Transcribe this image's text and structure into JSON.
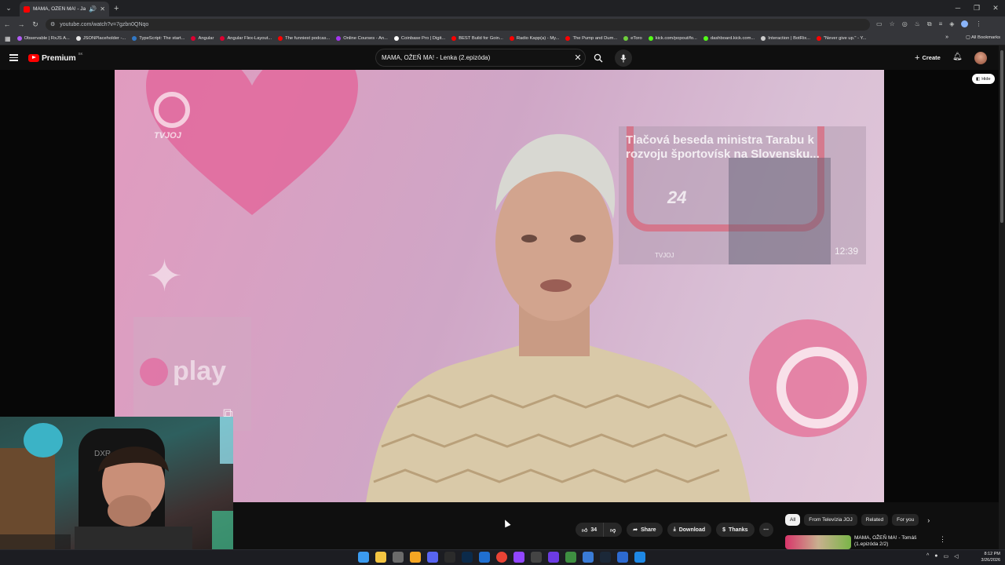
{
  "browser": {
    "tab_title": "MAMA, OŽEŇ MA! - Jarka |",
    "address": "youtube.com/watch?v=7gzbn0QNqo",
    "bookmarks": [
      {
        "label": "Observable | RxJS A...",
        "color": "#b05cf5"
      },
      {
        "label": "JSONPlaceholder -...",
        "color": "#e8e8e8"
      },
      {
        "label": "TypeScript: The start...",
        "color": "#3178c6"
      },
      {
        "label": "Angular",
        "color": "#dd0031"
      },
      {
        "label": "Angular Flex-Layout...",
        "color": "#dd0031"
      },
      {
        "label": "The funniest podcas...",
        "color": "#ff0000"
      },
      {
        "label": "Online Courses - An...",
        "color": "#a435f0"
      },
      {
        "label": "Coinbase Pro | Digit...",
        "color": "#ffffff"
      },
      {
        "label": "BEST Build for Goin...",
        "color": "#ff0000"
      },
      {
        "label": "Radio Kapp(a) - My...",
        "color": "#ff0000"
      },
      {
        "label": "The Pump and Dum...",
        "color": "#ff0000"
      },
      {
        "label": "eToro",
        "color": "#6fcf3c"
      },
      {
        "label": "kick.com/popout/fo...",
        "color": "#53fc18"
      },
      {
        "label": "dashboard.kick.com...",
        "color": "#53fc18"
      },
      {
        "label": "Interaction | BotRix...",
        "color": "#cccccc"
      },
      {
        "label": "\"Never give up.\" - Y...",
        "color": "#ff0000"
      }
    ],
    "all_bookmarks": "All Bookmarks"
  },
  "youtube": {
    "logo_text": "Premium",
    "logo_region": "SK",
    "search_query": "MAMA, OŽEŇ MA! - Lenka (2.epizóda)",
    "create_label": "Create"
  },
  "video": {
    "channel_watermark": "TVJOJ",
    "endcard_title": "Tlačová beseda ministra Tarabu k rozvoju športovísk na Slovensku...",
    "endcard_badge": "24",
    "endcard_duration": "12:39",
    "endcard_logo": "TVJOJ",
    "play_logo": "play",
    "hide_label": "Hide"
  },
  "actions": {
    "like_count": "34",
    "share": "Share",
    "download": "Download",
    "thanks": "Thanks"
  },
  "chips": [
    "All",
    "From Televízia JOJ",
    "Related",
    "For you"
  ],
  "related": {
    "title": "MAMA, OŽEŇ MA! - Tomáš (1.epizóda 2/2)"
  },
  "clock": {
    "time": "8:12 PM",
    "date": "3/26/2026"
  },
  "colors": {
    "youtube_red": "#ff0000",
    "background": "#0f0f0f",
    "video_pink": "#e19bbf"
  }
}
